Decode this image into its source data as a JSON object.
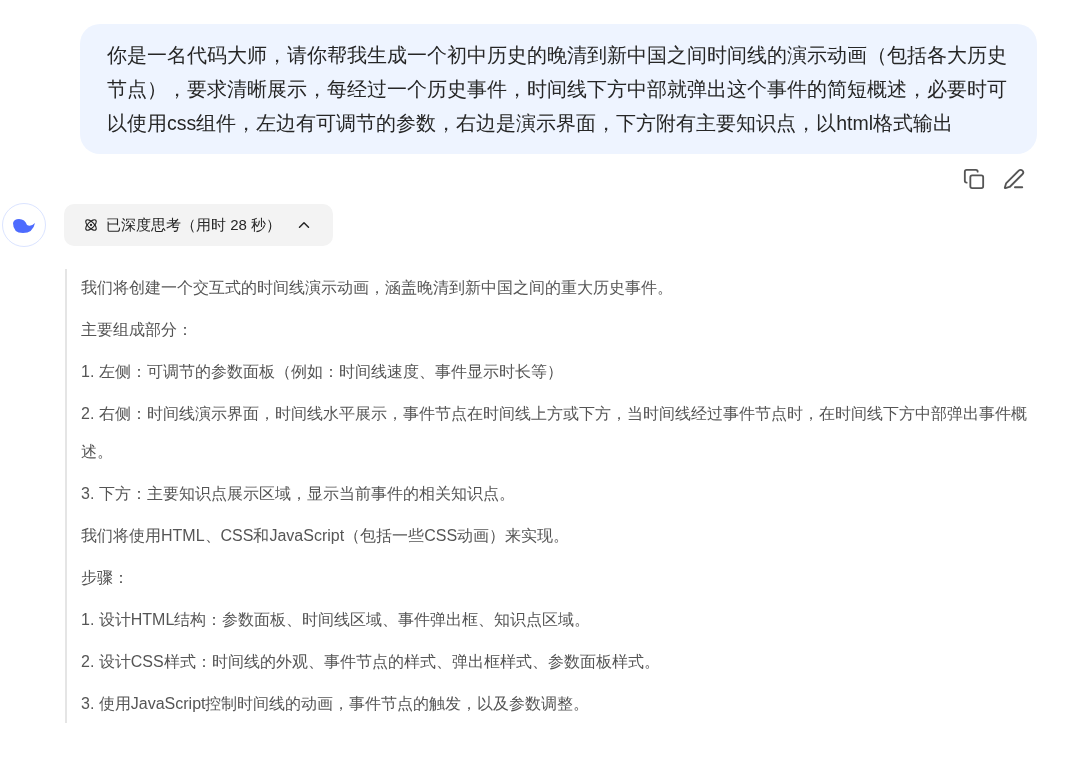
{
  "user_message": "你是一名代码大师，请你帮我生成一个初中历史的晚清到新中国之间时间线的演示动画（包括各大历史节点），要求清晰展示，每经过一个历史事件，时间线下方中部就弹出这个事件的简短概述，必要时可以使用css组件，左边有可调节的参数，右边是演示界面，下方附有主要知识点，以html格式输出",
  "thinking": {
    "label": "已深度思考（用时 28 秒）",
    "expanded": true
  },
  "thought_paragraphs": [
    "我们将创建一个交互式的时间线演示动画，涵盖晚清到新中国之间的重大历史事件。",
    "主要组成部分：",
    "1. 左侧：可调节的参数面板（例如：时间线速度、事件显示时长等）",
    "2. 右侧：时间线演示界面，时间线水平展示，事件节点在时间线上方或下方，当时间线经过事件节点时，在时间线下方中部弹出事件概述。",
    "3. 下方：主要知识点展示区域，显示当前事件的相关知识点。",
    "我们将使用HTML、CSS和JavaScript（包括一些CSS动画）来实现。",
    "步骤：",
    "1. 设计HTML结构：参数面板、时间线区域、事件弹出框、知识点区域。",
    "2. 设计CSS样式：时间线的外观、事件节点的样式、弹出框样式、参数面板样式。",
    "3. 使用JavaScript控制时间线的动画，事件节点的触发，以及参数调整。"
  ]
}
